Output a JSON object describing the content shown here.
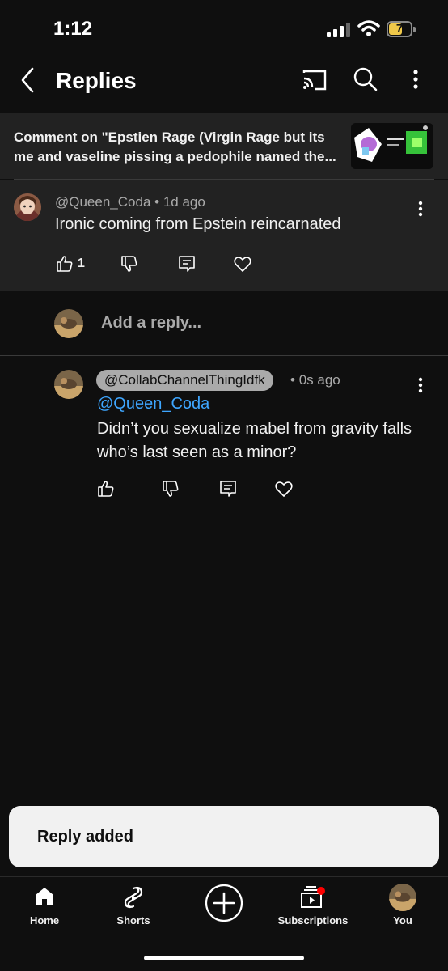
{
  "status": {
    "time": "1:12",
    "battery": "7"
  },
  "header": {
    "title": "Replies"
  },
  "context": {
    "text": "Comment on \"Epstien Rage (Virgin Rage but its me and vaseline pissing a pedophile named the..."
  },
  "parent_comment": {
    "author": "@Queen_Coda",
    "age": "1d ago",
    "body": "Ironic coming from Epstein reincarnated",
    "likes": "1"
  },
  "add_reply": {
    "placeholder": "Add a reply..."
  },
  "reply": {
    "author": "@CollabChannelThingIdfk",
    "age": "0s ago",
    "mention": "@Queen_Coda",
    "body": "Didn’t you sexualize mabel from gravity falls who’s last seen as a minor?"
  },
  "toast": {
    "text": "Reply added"
  },
  "nav": {
    "items": [
      {
        "label": "Home",
        "icon": "home-icon"
      },
      {
        "label": "Shorts",
        "icon": "shorts-icon"
      },
      {
        "label": "",
        "icon": "create-icon"
      },
      {
        "label": "Subscriptions",
        "icon": "subscriptions-icon"
      },
      {
        "label": "You",
        "icon": "avatar"
      }
    ]
  },
  "colors": {
    "background": "#0f0f0f",
    "panel": "#222222",
    "mention": "#3ea6ff",
    "notification": "#ff0000"
  }
}
